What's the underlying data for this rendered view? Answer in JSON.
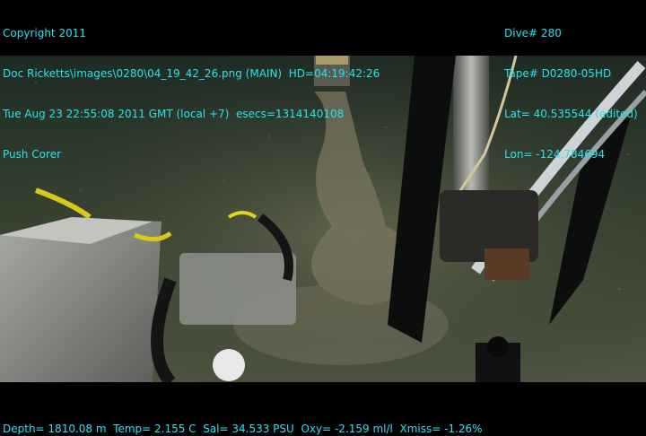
{
  "overlay": {
    "top_left": [
      "Copyright 2011",
      "Doc Ricketts\\images\\0280\\04_19_42_26.png (MAIN)  HD=04:19:42:26",
      "Tue Aug 23 22:55:08 2011 GMT (local +7)  esecs=1314140108",
      "Push Corer"
    ],
    "top_right": [
      "Dive# 280",
      "Tape# D0280-05HD",
      "Lat= 40.535544 (edited)",
      "Lon= -124.784694"
    ],
    "bottom": "Depth= 1810.08 m  Temp= 2.155 C  Sal= 34.533 PSU  Oxy= -2.159 ml/l  Xmiss= -1.26%"
  },
  "colors": {
    "overlay_text": "#27e3ee",
    "seafloor": "#3f4a3a",
    "background": "#000000"
  }
}
